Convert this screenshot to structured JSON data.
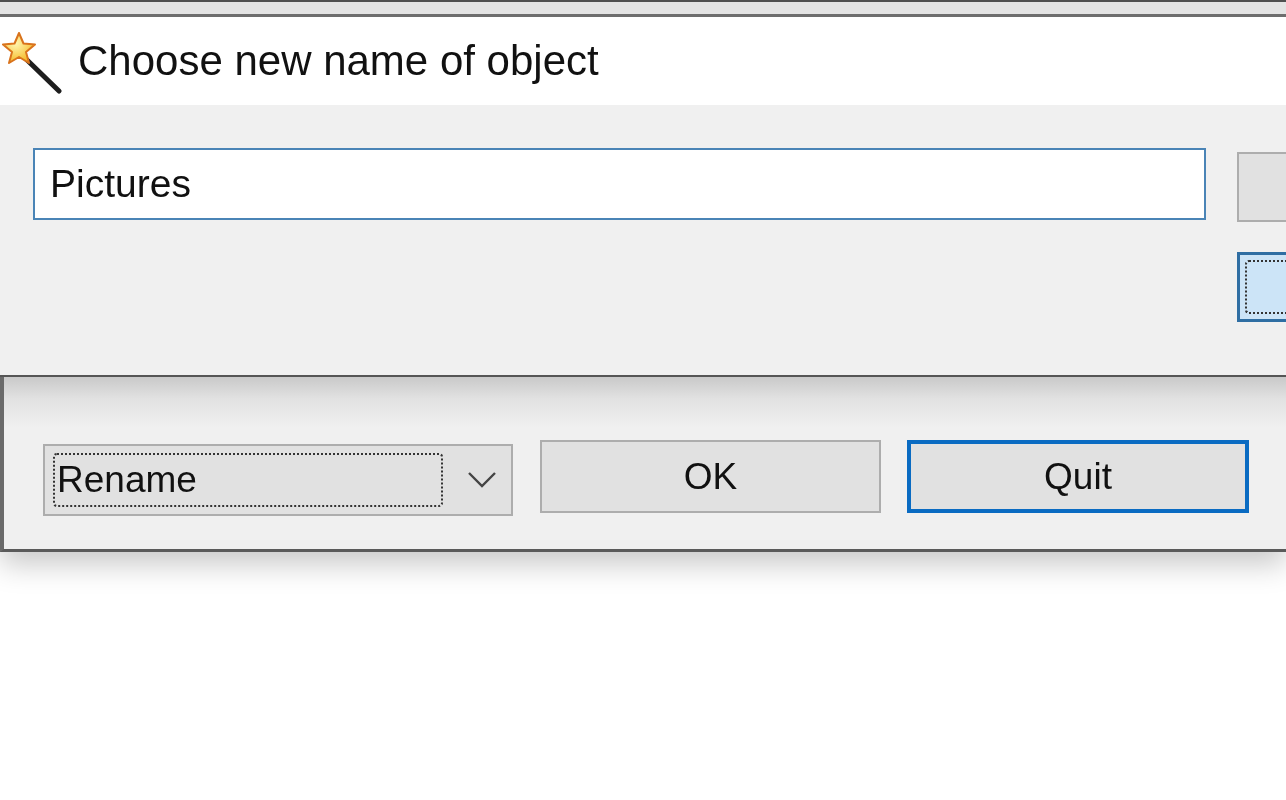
{
  "dialog": {
    "title": "Choose new name of object",
    "name_field": {
      "value": "Pictures"
    },
    "side_buttons": [
      {
        "focused": false
      },
      {
        "focused": true
      }
    ]
  },
  "main_window": {
    "action_select": {
      "value": "Rename",
      "focused": true
    },
    "buttons": [
      {
        "label": "OK",
        "default": false
      },
      {
        "label": "Quit",
        "default": true
      }
    ]
  }
}
